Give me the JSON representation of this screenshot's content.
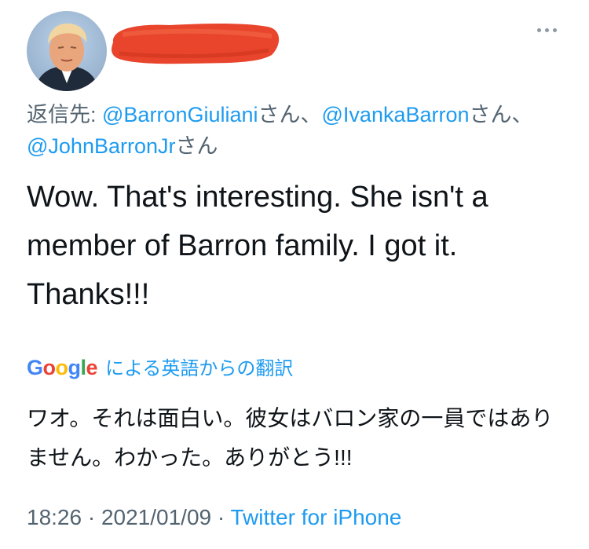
{
  "header": {
    "more_icon": "more-horizontal-icon"
  },
  "reply_to": {
    "prefix": "返信先: ",
    "handles": [
      {
        "handle": "@BarronGiuliani",
        "suffix": "さん、"
      },
      {
        "handle": "@IvankaBarron",
        "suffix": "さん、"
      },
      {
        "handle": "@JohnBarronJr",
        "suffix": "さん"
      }
    ]
  },
  "tweet": {
    "text": "Wow. That's interesting. She isn't a member of Barron family. I got it. Thanks!!!"
  },
  "translation": {
    "google_logo": "Google",
    "label": "による英語からの翻訳",
    "text": "ワオ。それは面白い。彼女はバロン家の一員ではありません。わかった。ありがとう!!!"
  },
  "meta": {
    "time": "18:26",
    "separator1": " · ",
    "date": "2021/01/09",
    "separator2": " · ",
    "source": "Twitter for iPhone"
  },
  "colors": {
    "link": "#1d9bf0",
    "muted": "#536471",
    "redaction": "#e8452c"
  }
}
